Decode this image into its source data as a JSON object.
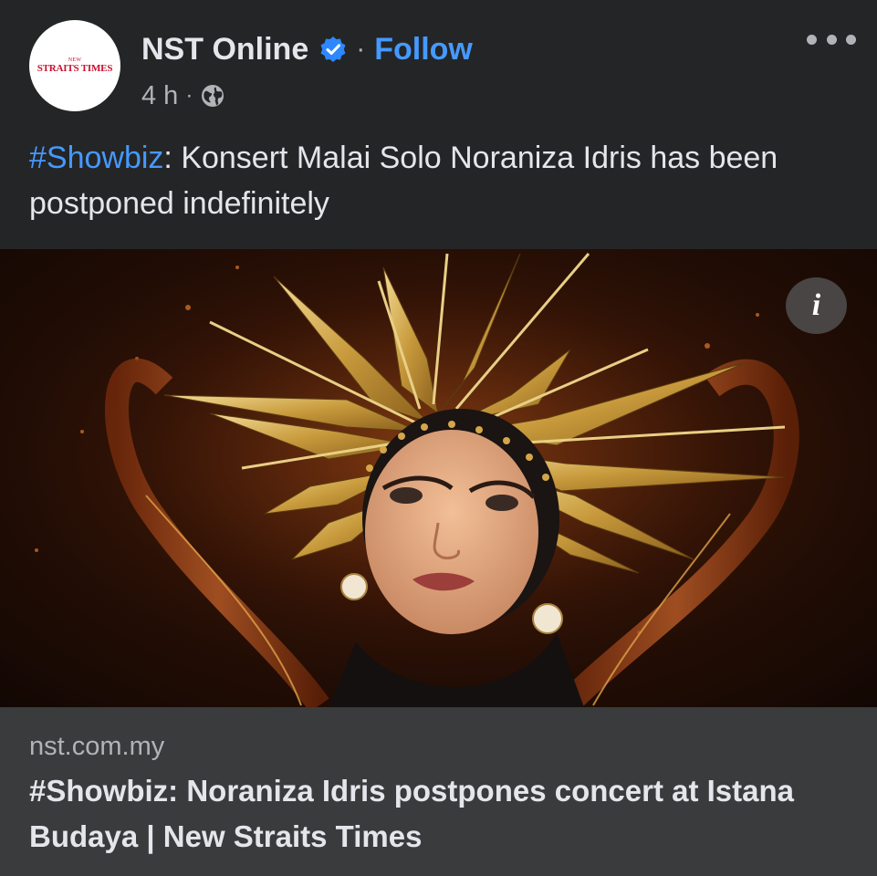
{
  "post": {
    "avatar": {
      "small_text": "NEW",
      "brand_text": "STRAITS TIMES"
    },
    "page_name": "NST Online",
    "separator": "·",
    "follow_label": "Follow",
    "timestamp": "4 h",
    "meta_separator": "·",
    "privacy_icon": "globe-icon",
    "verified_icon": "verified-badge-icon",
    "text": {
      "hashtag": "#Showbiz",
      "body": ": Konsert Malai Solo Noraniza Idris has been postponed indefinitely"
    }
  },
  "link_preview": {
    "info_label": "i",
    "domain": "nst.com.my",
    "title": "#Showbiz: Noraniza Idris postpones concert at Istana Budaya | New Straits Times"
  },
  "colors": {
    "background": "#242526",
    "link_blue": "#4599ff",
    "verified_blue": "#2d88ff",
    "footer_bg": "#3a3b3c",
    "secondary_text": "#b0b3b8"
  }
}
